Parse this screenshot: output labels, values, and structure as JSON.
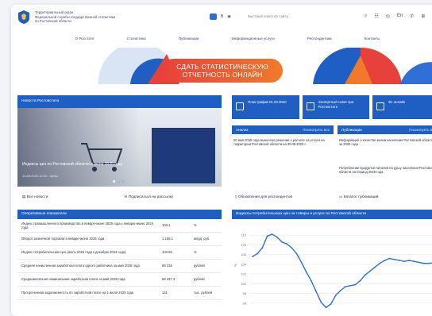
{
  "header": {
    "org_lines": [
      "Территориальный орган",
      "Федеральной службы государственной статистики",
      "по Ростовской области"
    ],
    "icons": [
      "telegram-icon",
      "vk-icon",
      "accessibility-icon"
    ],
    "search_placeholder": "Быстрый поиск по сайту",
    "right_icons": [
      "search-icon",
      "sitemap-icon",
      "eye-icon",
      "language-icon",
      "phone-icon",
      "globe-icon"
    ],
    "lang_label": "En"
  },
  "nav": {
    "items": [
      "О Росстате",
      "Статистика",
      "Публикации",
      "Информационные услуги",
      "Респондентам",
      "Контакты"
    ]
  },
  "banner": {
    "cta_line1": "СДАТЬ СТАТИСТИЧЕСКУЮ",
    "cta_line2": "ОТЧЕТНОСТЬ ОНЛАЙН"
  },
  "news": {
    "title": "Новости Ростовстата",
    "caption": "Индексы цен по Ростовской области в июле 2025 года",
    "date": "14.08.2025 12:01",
    "tag": "Цены",
    "links": [
      "Все новости",
      "Подписаться на рассылку"
    ]
  },
  "tiles": [
    {
      "label": "План-график 01.00.0040",
      "icon": "calendar-icon"
    },
    {
      "label": "Экспертный совет при Ростовстате",
      "icon": "people-icon"
    },
    {
      "label": "В1 онлайн",
      "icon": "doc-icon"
    }
  ],
  "analysis": {
    "title": "Анализ",
    "more": "Посмотреть все",
    "text": "20 мая 2025 года вынесено решение о расчете на услуги на территории Ростовской области на 30.08.2025 г."
  },
  "publications": {
    "title": "Публикации",
    "more": "Посмотреть все",
    "text1": "Информация о качестве жизни населения Ростовской области за 2025 года",
    "text2": "Потребление продуктов питания на душу населения Ростовской области на период 2025 года"
  },
  "col_links": [
    "Обновления для респондентов",
    "Каталог публикаций"
  ],
  "indicators": {
    "title": "Оперативные показатели",
    "rows": [
      {
        "name": "Индекс промышленного производства в январе-июне 2025 года к январю-июню 2024 года",
        "value": "103.1",
        "unit": "%"
      },
      {
        "name": "Оборот розничной торговли в январе-июне 2025 года",
        "value": "1 155.1",
        "unit": "млрд. руб."
      },
      {
        "name": "Индекс потребительских цен (июль 2025 года к декабрю 2024 года)",
        "value": "103.55",
        "unit": "%"
      },
      {
        "name": "Средняя начисленная заработная плата одного работника за май 2025 года",
        "value": "68 316",
        "unit": "рублей"
      },
      {
        "name": "Среднемесячная номинальная заработная плата за май 2025 года",
        "value": "68 437.3",
        "unit": "рублей"
      },
      {
        "name": "Просроченная задолженность по заработной плате на 1 июля 2025 года",
        "value": "141",
        "unit": "тыс. рублей"
      }
    ]
  },
  "chart_panel": {
    "title": "Индексы потребительских цен на товары и услуги по Ростовской области",
    "toggle_icon": "chevron-down-icon"
  },
  "chart_data": {
    "type": "line",
    "title": "",
    "xlabel": "",
    "ylabel": "%",
    "ylim": [
      94,
      112
    ],
    "y_ticks": [
      96,
      98,
      100,
      102,
      104,
      106,
      108,
      110
    ],
    "grid": true,
    "series": [
      {
        "values": [
          105.6,
          106.2,
          107.4,
          109.8,
          110.2,
          109.6,
          108.6,
          108.2,
          107.4,
          106.2,
          104.4,
          102.4,
          100.6,
          98.4,
          96.2,
          95.1,
          95.8,
          97.6,
          98.6,
          99.4,
          99.6,
          99.8,
          100.6,
          101.8,
          102.6,
          103.4,
          104.2,
          104.8,
          105.2,
          105.0,
          104.8,
          104.6,
          104.8,
          104.6,
          104.4,
          104.2,
          104.2,
          104.3
        ],
        "color": "#2f6fd6"
      }
    ]
  },
  "colors": {
    "brand_blue": "#1f5fc4",
    "cta_red": "#e8413b",
    "cta_orange": "#f07a2a"
  }
}
